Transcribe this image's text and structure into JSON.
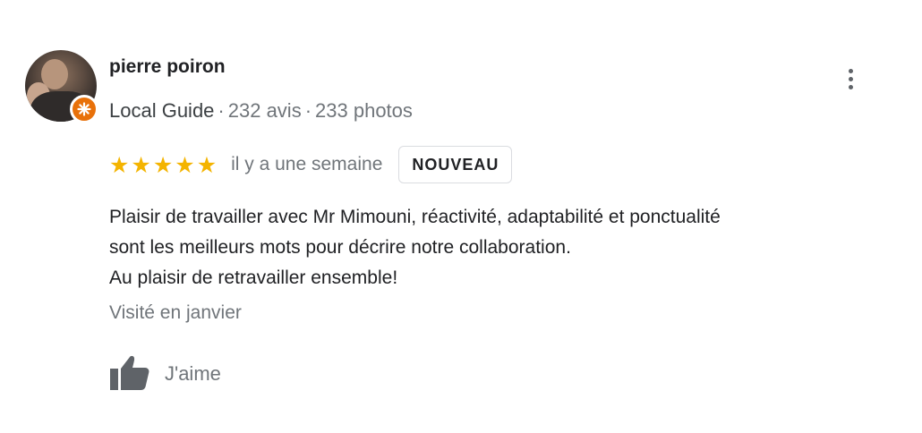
{
  "reviewer": {
    "name": "pierre poiron",
    "level": "Local Guide",
    "reviews_count": "232 avis",
    "photos_count": "233 photos",
    "separator": "·"
  },
  "review": {
    "rating": 5,
    "rating_max": 5,
    "date": "il y a une semaine",
    "badge": "NOUVEAU",
    "lines": [
      "Plaisir de travailler avec Mr Mimouni, réactivité, adaptabilité et ponctualité",
      "sont les meilleurs mots pour décrire notre collaboration.",
      "Au plaisir de retravailler ensemble!"
    ],
    "visited": "Visité en janvier"
  },
  "actions": {
    "like_label": "J'aime",
    "more_icon": "more-vertical-icon",
    "like_icon": "thumb-up-icon"
  },
  "colors": {
    "star": "#f4b400",
    "badge": "#e8710a",
    "secondary_text": "#70757a"
  }
}
